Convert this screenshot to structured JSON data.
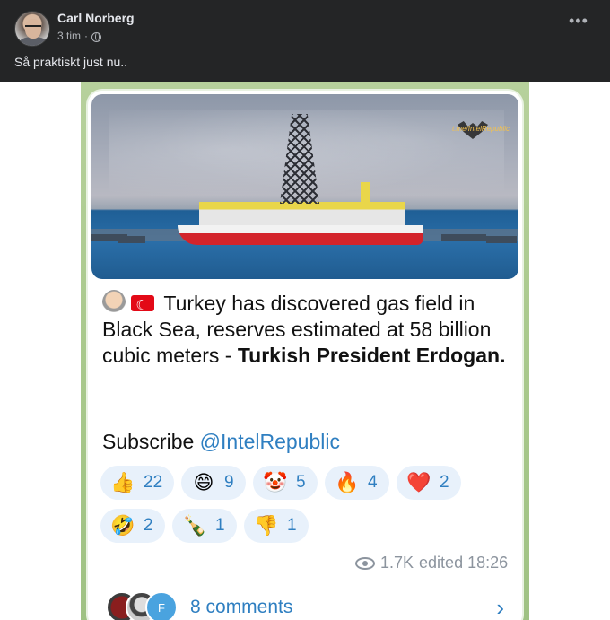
{
  "post": {
    "author": "Carl Norberg",
    "time": "3 tim",
    "dot": "·",
    "caption": "Så praktiskt just nu..",
    "more_icon": "more-icon"
  },
  "telegram": {
    "watermark": "t.me/IntelRepublic",
    "message_plain": "Turkey has discovered gas field in Black Sea, reserves estimated at 58 billion cubic meters - ",
    "message_bold": "Turkish President Erdogan.",
    "subscribe_prefix": "Subscribe ",
    "subscribe_link": "@IntelRepublic",
    "reactions": [
      {
        "emoji": "👍",
        "count": "22"
      },
      {
        "emoji": "😄",
        "count": "9"
      },
      {
        "emoji": "🤡",
        "count": "5"
      },
      {
        "emoji": "🔥",
        "count": "4"
      },
      {
        "emoji": "❤️",
        "count": "2"
      },
      {
        "emoji": "🤣",
        "count": "2"
      },
      {
        "emoji": "🍾",
        "count": "1"
      },
      {
        "emoji": "👎",
        "count": "1"
      }
    ],
    "views": "1.7K",
    "edited": "edited 18:26",
    "commenter_initial": "F",
    "comments": "8 comments",
    "chevron": "›",
    "accent": "#2f7fc1"
  }
}
